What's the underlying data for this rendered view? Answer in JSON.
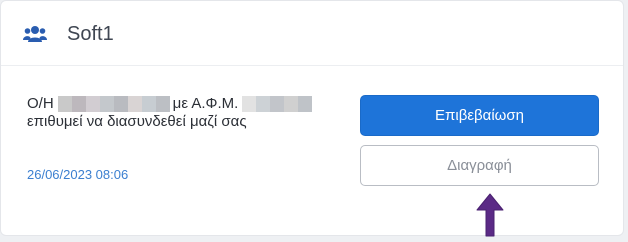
{
  "header": {
    "icon": "users-icon",
    "title": "Soft1"
  },
  "message": {
    "prefix": "Ο/Η",
    "middle": "με Α.Φ.Μ.",
    "line2": "επιθυμεί να διασυνδεθεί μαζί σας"
  },
  "date": "26/06/2023 08:06",
  "buttons": {
    "confirm_label": "Επιβεβαίωση",
    "delete_label": "Διαγραφή"
  },
  "colors": {
    "primary": "#1e74d9",
    "date": "#3b7fd0",
    "icon": "#2a5db0",
    "arrow": "#5b2a86"
  }
}
